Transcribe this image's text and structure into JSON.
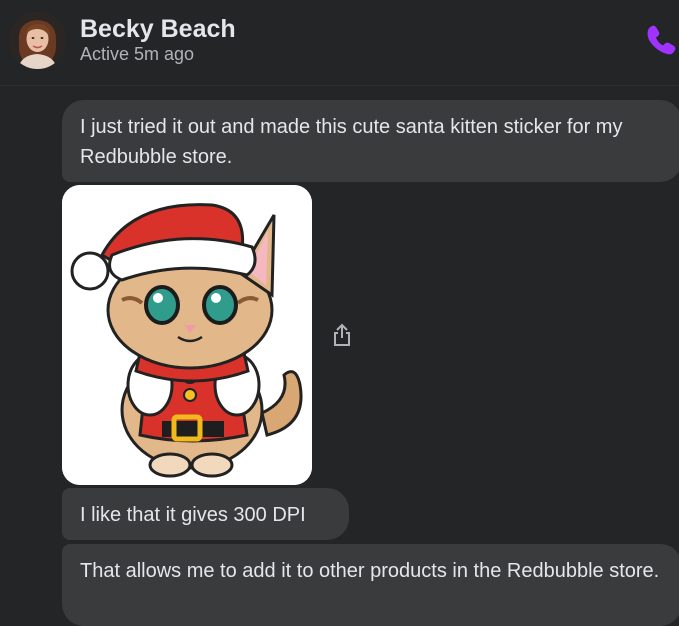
{
  "header": {
    "name": "Becky Beach",
    "status": "Active 5m ago",
    "call_icon": "phone-icon"
  },
  "messages": [
    {
      "type": "text",
      "text": "I just tried it out and made this cute santa kitten sticker for my Redbubble store."
    },
    {
      "type": "image",
      "description_icon": "santa-kitten-sticker-image"
    },
    {
      "type": "text",
      "text": "I like that it gives 300 DPI"
    },
    {
      "type": "text",
      "text": "That allows me to add it to other products in the Redbubble store."
    }
  ],
  "colors": {
    "background": "#242526",
    "bubble": "#3a3b3c",
    "accent": "#a033ff"
  }
}
